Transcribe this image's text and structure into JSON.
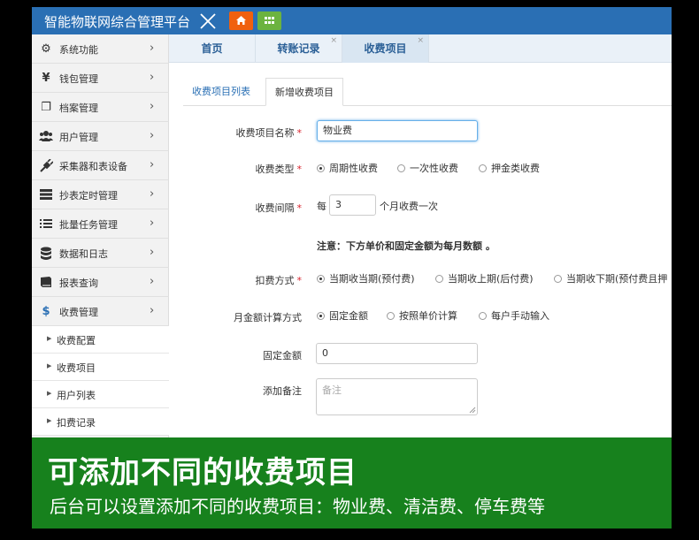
{
  "app": {
    "title": "智能物联网综合管理平台"
  },
  "sidebar": {
    "items": [
      {
        "label": "系统功能",
        "icon": "gears-icon"
      },
      {
        "label": "钱包管理",
        "icon": "yen-icon"
      },
      {
        "label": "档案管理",
        "icon": "files-icon"
      },
      {
        "label": "用户管理",
        "icon": "users-icon"
      },
      {
        "label": "采集器和表设备",
        "icon": "plug-icon"
      },
      {
        "label": "抄表定时管理",
        "icon": "server-icon"
      },
      {
        "label": "批量任务管理",
        "icon": "list-icon"
      },
      {
        "label": "数据和日志",
        "icon": "database-icon"
      },
      {
        "label": "报表查询",
        "icon": "book-icon"
      },
      {
        "label": "收费管理",
        "icon": "dollar-icon"
      }
    ],
    "sub_items": [
      "收费配置",
      "收费项目",
      "用户列表",
      "扣费记录"
    ]
  },
  "tabs": [
    {
      "label": "首页"
    },
    {
      "label": "转账记录",
      "close": "×"
    },
    {
      "label": "收费项目",
      "close": "×"
    }
  ],
  "subtabs": {
    "list": "收费项目列表",
    "add": "新增收费项目"
  },
  "form": {
    "name_label": "收费项目名称",
    "name_value": "物业费",
    "type_label": "收费类型",
    "type_options": [
      "周期性收费",
      "一次性收费",
      "押金类收费"
    ],
    "interval_label": "收费间隔",
    "interval_prefix": "每",
    "interval_value": "3",
    "interval_suffix": "个月收费一次",
    "note": "注意：下方单价和固定金额为每月数额 。",
    "deduct_label": "扣费方式",
    "deduct_options": [
      "当期收当期(预付费)",
      "当期收上期(后付费)",
      "当期收下期(预付费且押"
    ],
    "calc_label": "月金额计算方式",
    "calc_options": [
      "固定金额",
      "按照单价计算",
      "每户手动输入"
    ],
    "fixed_label": "固定金额",
    "fixed_value": "0",
    "remark_label": "添加备注",
    "remark_placeholder": "备注",
    "required_mark": "*"
  },
  "banner": {
    "title": "可添加不同的收费项目",
    "subtitle": "后台可以设置添加不同的收费项目：物业费、清洁费、停车费等"
  },
  "colors": {
    "topbar": "#2a6fb4",
    "banner": "#17811d",
    "home_button": "#f0600f",
    "grid_button": "#6cb33f"
  }
}
